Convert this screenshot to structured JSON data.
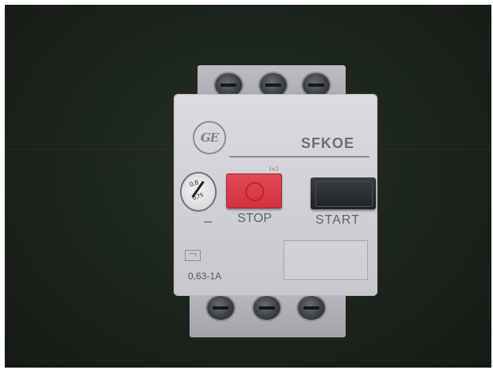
{
  "device": {
    "brand_logo": "GE",
    "model": "SFKOE",
    "stop_label": "STOP",
    "start_label": "START",
    "current_range": "0,63-1A",
    "pull_mark": "I<I",
    "dial": {
      "top_text": "0,8",
      "bottom_text": "0,75"
    }
  },
  "icons": {
    "logo": "ge-logo-icon",
    "thermal": "thermal-overload-icon"
  },
  "colors": {
    "stop_button": "#d4303e",
    "start_button": "#202326",
    "plate": "#d4d4d8",
    "background": "#1d261d"
  }
}
